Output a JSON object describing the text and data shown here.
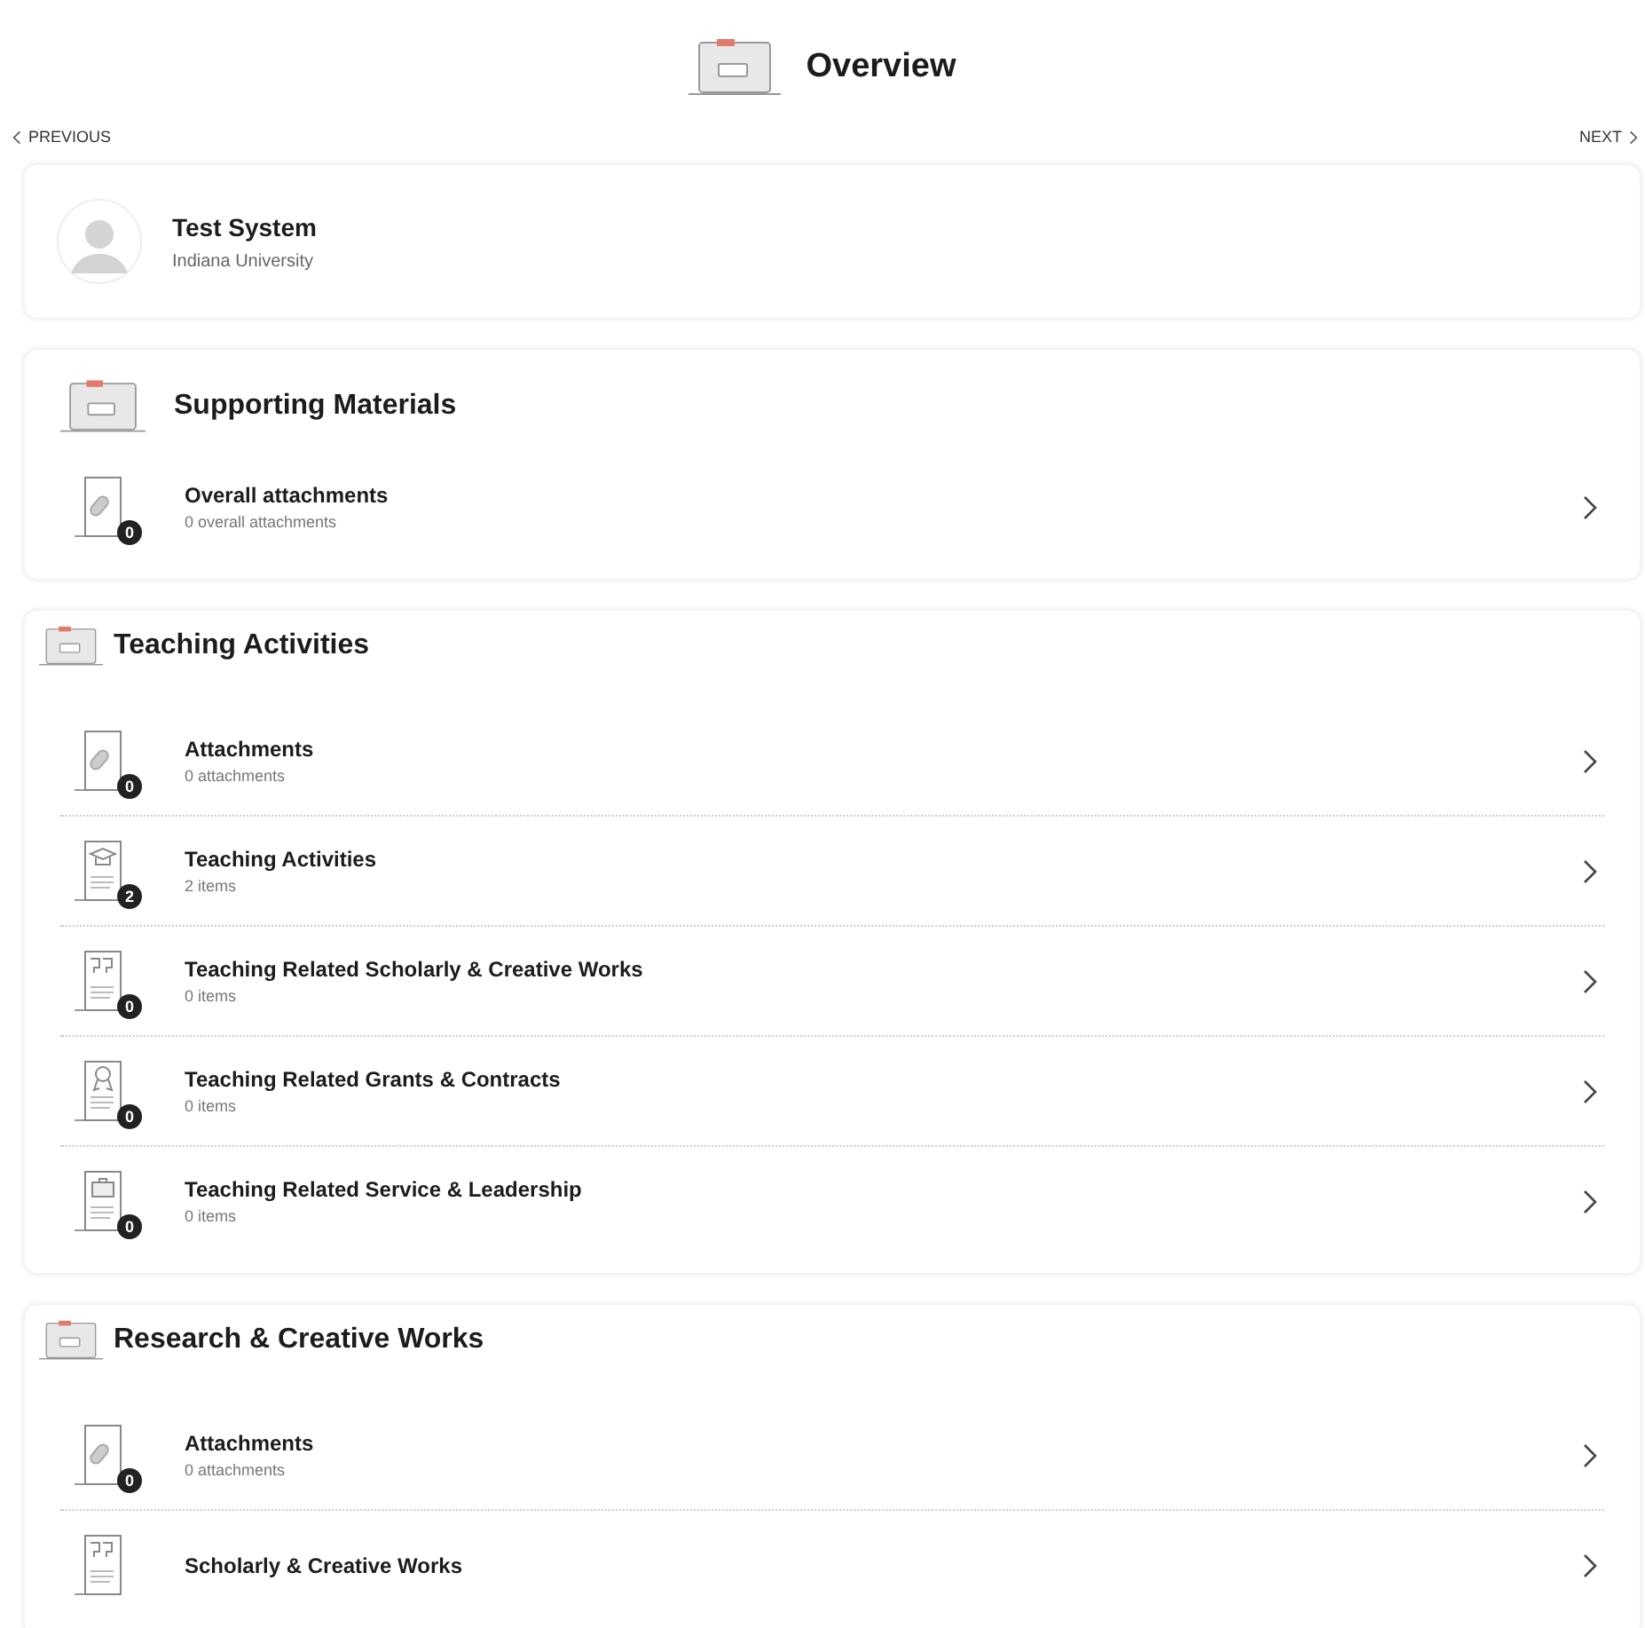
{
  "header": {
    "title": "Overview"
  },
  "nav": {
    "previous": "PREVIOUS",
    "next": "NEXT"
  },
  "profile": {
    "name": "Test System",
    "institution": "Indiana University"
  },
  "sections": [
    {
      "kind": "large",
      "title": "Supporting Materials",
      "items": [
        {
          "kind": "attachment",
          "title": "Overall attachments",
          "subtitle": "0 overall attachments",
          "count": "0"
        }
      ]
    },
    {
      "kind": "compact",
      "title": "Teaching Activities",
      "items": [
        {
          "kind": "attachment",
          "title": "Attachments",
          "subtitle": "0 attachments",
          "count": "0"
        },
        {
          "kind": "cap",
          "title": "Teaching Activities",
          "subtitle": "2 items",
          "count": "2"
        },
        {
          "kind": "quote",
          "title": "Teaching Related Scholarly & Creative Works",
          "subtitle": "0 items",
          "count": "0"
        },
        {
          "kind": "award",
          "title": "Teaching Related Grants & Contracts",
          "subtitle": "0 items",
          "count": "0"
        },
        {
          "kind": "briefcase",
          "title": "Teaching Related Service & Leadership",
          "subtitle": "0 items",
          "count": "0"
        }
      ]
    },
    {
      "kind": "compact",
      "title": "Research & Creative Works",
      "items": [
        {
          "kind": "attachment",
          "title": "Attachments",
          "subtitle": "0 attachments",
          "count": "0"
        },
        {
          "kind": "quote",
          "title": "Scholarly & Creative Works"
        }
      ]
    }
  ]
}
